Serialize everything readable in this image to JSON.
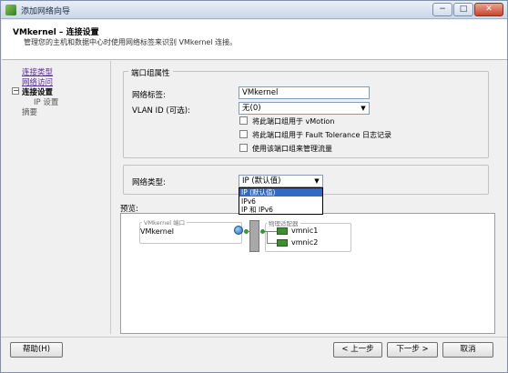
{
  "window": {
    "title": "添加网络向导",
    "min": "−",
    "max": "□",
    "close": "✕"
  },
  "header": {
    "title": "VMkernel – 连接设置",
    "description": "管理您的主机和数据中心时使用网络标签来识别 VMkernel 连接。"
  },
  "nav": {
    "items": [
      {
        "label": "连接类型",
        "state": "link"
      },
      {
        "label": "网络访问",
        "state": "link"
      },
      {
        "label": "连接设置",
        "state": "current"
      },
      {
        "label": "IP 设置",
        "state": "sub"
      },
      {
        "label": "摘要",
        "state": "pending"
      }
    ],
    "expander": "−"
  },
  "port_group": {
    "legend": "端口组属性",
    "network_label_label": "网络标签:",
    "network_label_value": "VMkernel",
    "vlan_label": "VLAN ID (可选):",
    "vlan_value": "无(0)",
    "checkboxes": [
      {
        "label": "将此端口组用于 vMotion",
        "checked": false
      },
      {
        "label": "将此端口组用于 Fault Tolerance 日志记录",
        "checked": false
      },
      {
        "label": "使用该端口组来管理流量",
        "checked": false
      }
    ]
  },
  "network_type": {
    "label": "网络类型:",
    "selected": "IP (默认值)",
    "options": [
      "IP (默认值)",
      "IPv6",
      "IP 和 IPv6"
    ]
  },
  "preview": {
    "label": "预览:",
    "vmkernel_caption": "VMkernel 端口",
    "vmkernel_name": "VMkernel",
    "uplink_caption": "物理适配器",
    "adapters": [
      "vmnic1",
      "vmnic2"
    ]
  },
  "footer": {
    "help": "帮助(H)",
    "back": "< 上一步",
    "next": "下一步 >",
    "cancel": "取消"
  },
  "colors": {
    "link": "#5a2ca0",
    "selection": "#3169c6",
    "nic": "#3f8e2f"
  },
  "icons": [
    "app-icon",
    "globe-icon",
    "nic-icon",
    "minus-icon",
    "chevron-down-icon"
  ]
}
